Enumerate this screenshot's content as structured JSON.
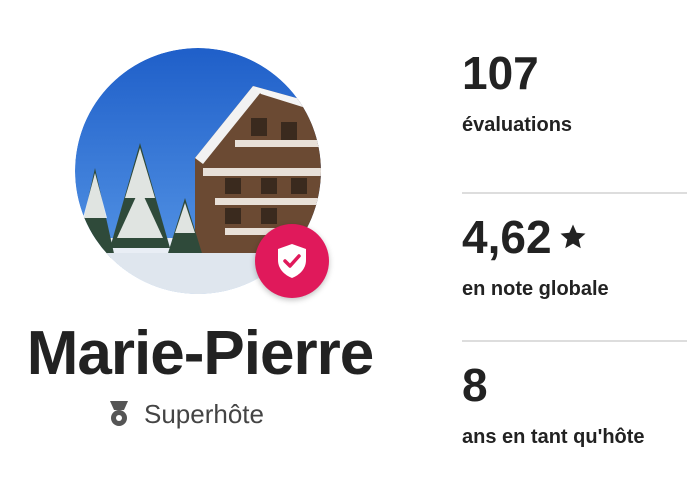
{
  "profile": {
    "name": "Marie-Pierre",
    "status": "Superhôte",
    "badge_color": "#e0195b",
    "avatar_icon": "chalet-snow-photo",
    "badge_icon": "shield-check-icon",
    "status_icon": "superhost-medal-icon"
  },
  "stats": [
    {
      "value": "107",
      "caption": "évaluations"
    },
    {
      "value": "4,62",
      "caption": "en note globale",
      "icon": "star-icon"
    },
    {
      "value": "8",
      "caption": "ans en tant qu'hôte"
    }
  ]
}
